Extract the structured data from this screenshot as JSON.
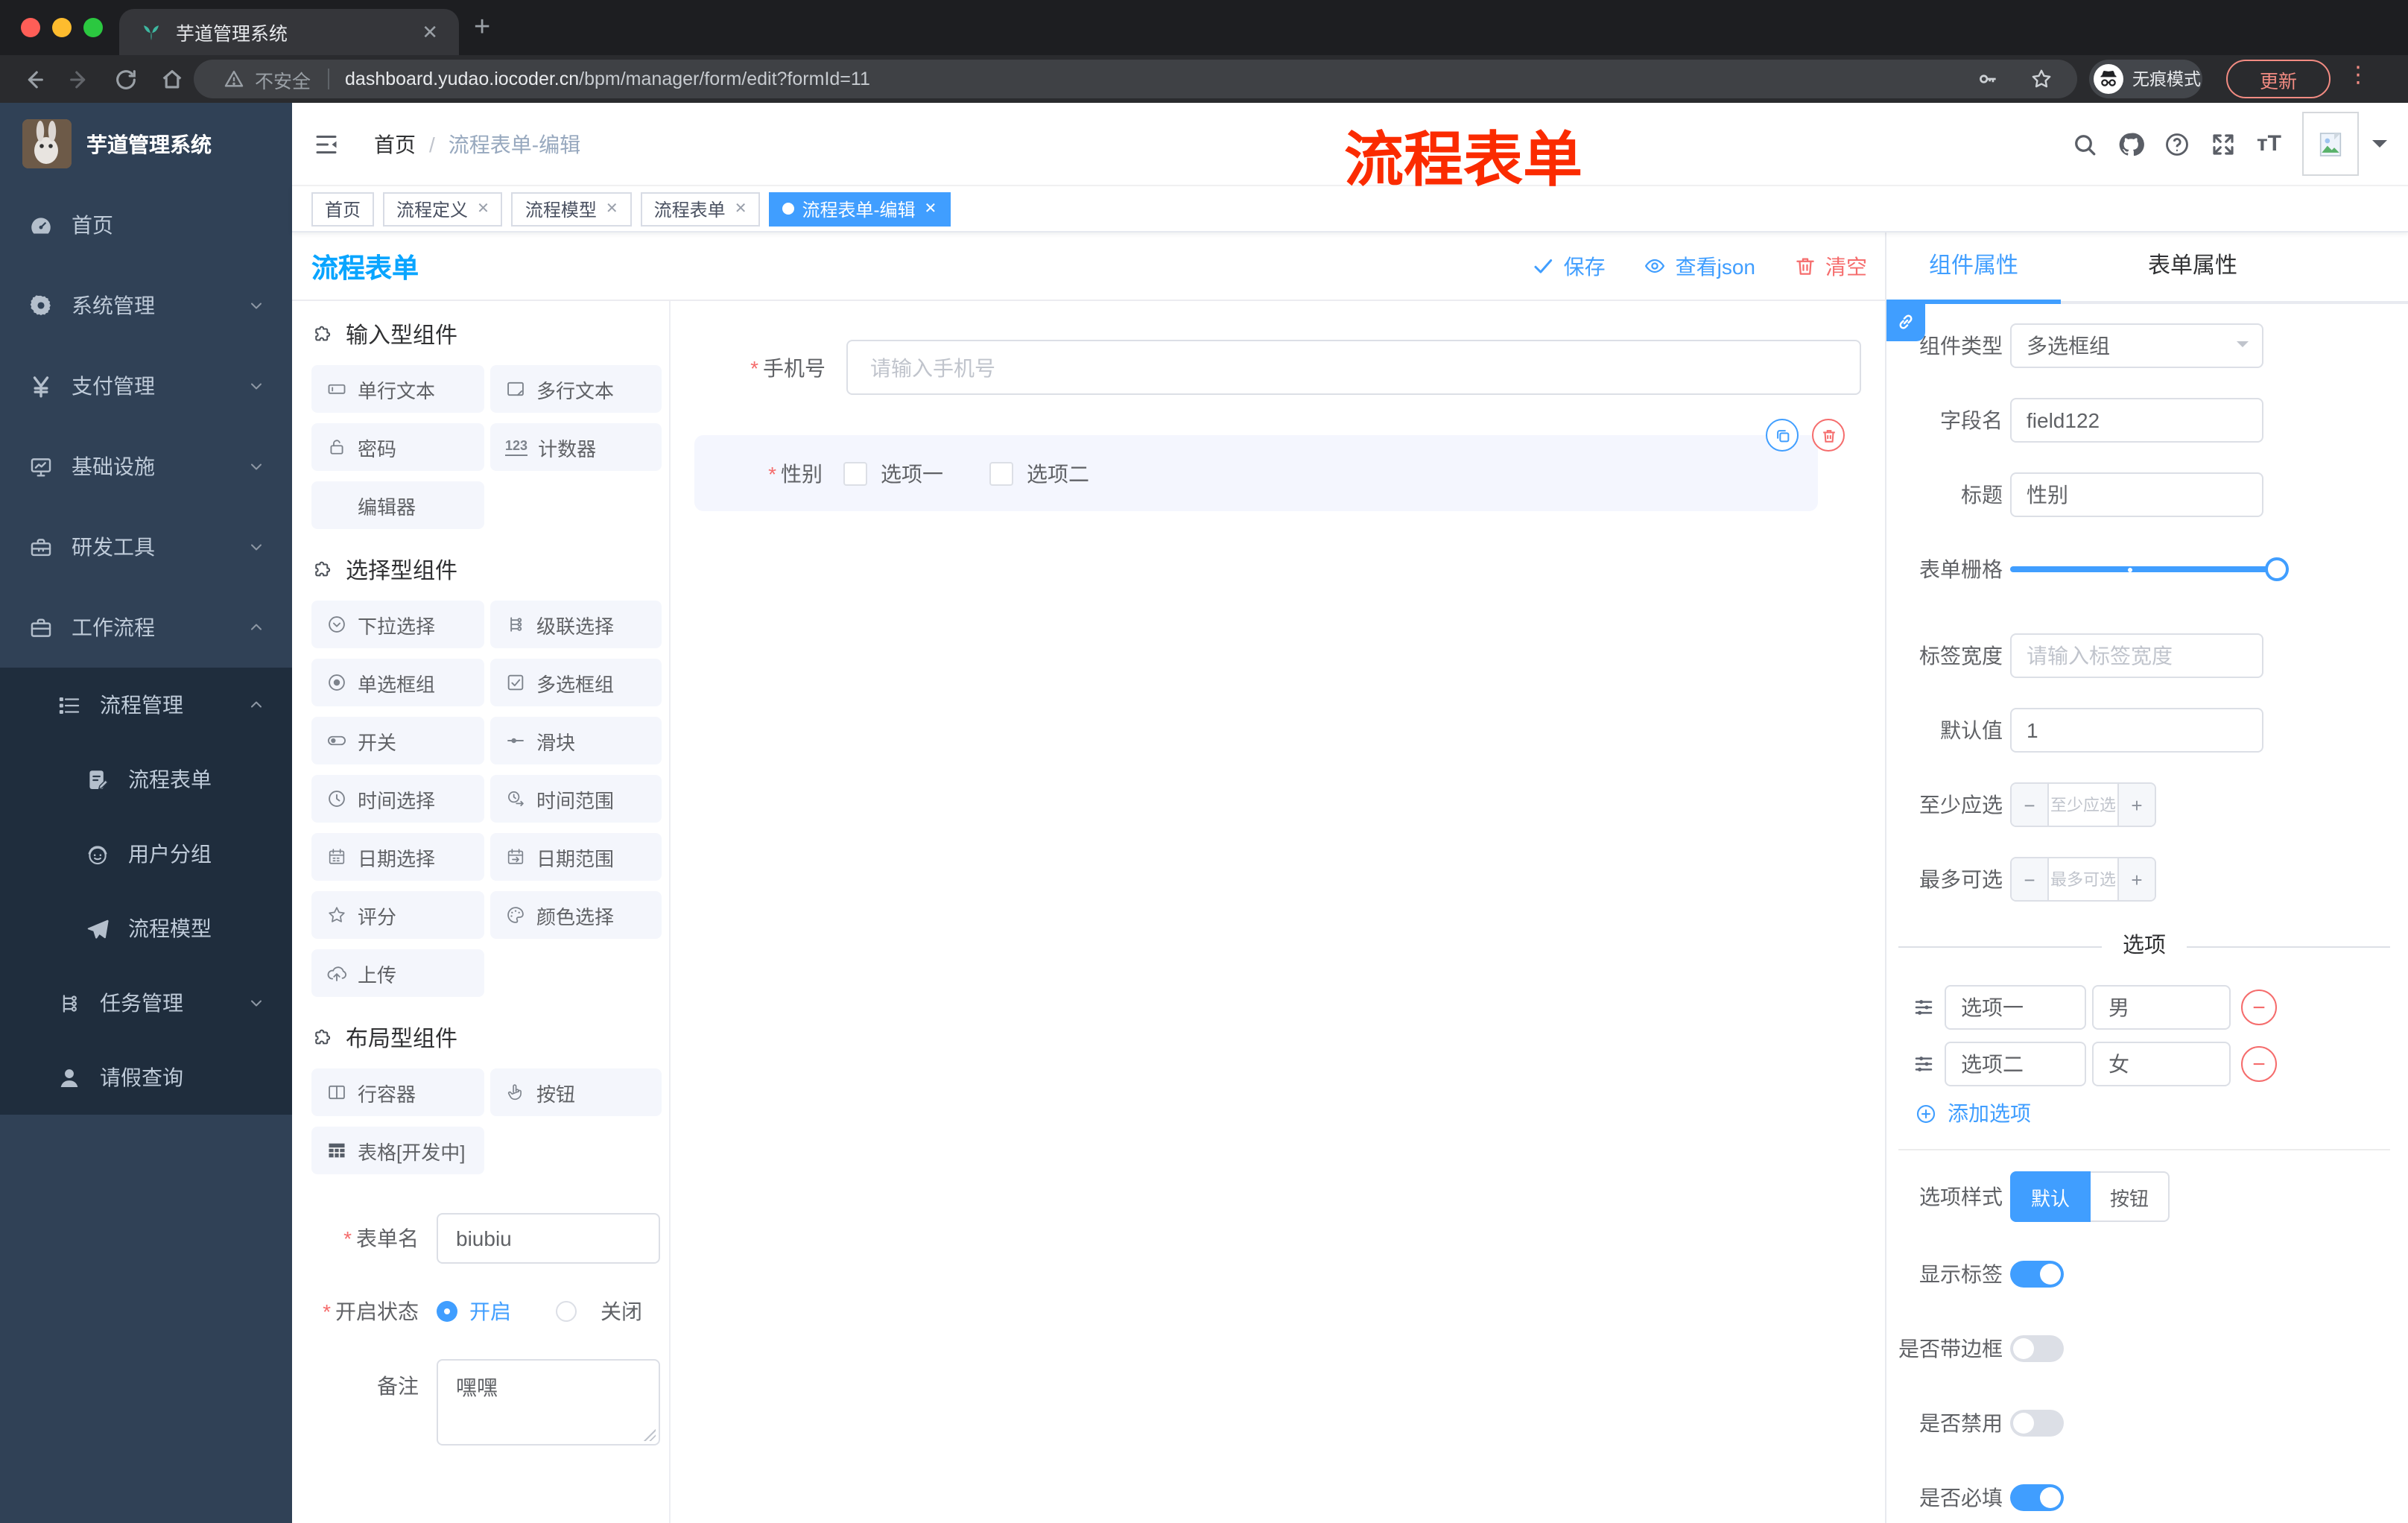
{
  "browser": {
    "tab_title": "芋道管理系统",
    "not_secure": "不安全",
    "url_domain": "dashboard.yudao.iocoder.cn",
    "url_path": "/bpm/manager/form/edit?formId=11",
    "incognito_label": "无痕模式",
    "update_label": "更新"
  },
  "header": {
    "breadcrumb_home": "首页",
    "breadcrumb_sep": "/",
    "breadcrumb_current": "流程表单-编辑",
    "annotation": "流程表单"
  },
  "sidebar": {
    "logo_title": "芋道管理系统",
    "items": [
      {
        "id": "home",
        "label": "首页",
        "icon": "dashboard",
        "level": 1,
        "chevron": ""
      },
      {
        "id": "system",
        "label": "系统管理",
        "icon": "gear",
        "level": 1,
        "chevron": "down"
      },
      {
        "id": "pay",
        "label": "支付管理",
        "icon": "yen",
        "level": 1,
        "chevron": "down"
      },
      {
        "id": "infra",
        "label": "基础设施",
        "icon": "monitor",
        "level": 1,
        "chevron": "down"
      },
      {
        "id": "devtool",
        "label": "研发工具",
        "icon": "toolbox",
        "level": 1,
        "chevron": "down"
      },
      {
        "id": "workflow",
        "label": "工作流程",
        "icon": "briefcase",
        "level": 1,
        "chevron": "up"
      },
      {
        "id": "process-mgmt",
        "label": "流程管理",
        "icon": "listcheck",
        "level": 2,
        "chevron": "up",
        "sub": true
      },
      {
        "id": "process-form",
        "label": "流程表单",
        "icon": "docedit",
        "level": 3,
        "chevron": "",
        "sub": true
      },
      {
        "id": "user-group",
        "label": "用户分组",
        "icon": "face",
        "level": 3,
        "chevron": "",
        "sub": true
      },
      {
        "id": "process-model",
        "label": "流程模型",
        "icon": "plane",
        "level": 3,
        "chevron": "",
        "sub": true
      },
      {
        "id": "task-mgmt",
        "label": "任务管理",
        "icon": "cascade",
        "level": 2,
        "chevron": "down",
        "sub": true
      },
      {
        "id": "leave-query",
        "label": "请假查询",
        "icon": "user",
        "level": 2,
        "chevron": "",
        "sub": true
      }
    ]
  },
  "tags": [
    {
      "label": "首页",
      "closable": false,
      "active": false
    },
    {
      "label": "流程定义",
      "closable": true,
      "active": false
    },
    {
      "label": "流程模型",
      "closable": true,
      "active": false
    },
    {
      "label": "流程表单",
      "closable": true,
      "active": false
    },
    {
      "label": "流程表单-编辑",
      "closable": true,
      "active": true
    }
  ],
  "designer": {
    "panel_title": "流程表单",
    "actions": [
      {
        "id": "save",
        "label": "保存",
        "icon": "check",
        "color": "blue"
      },
      {
        "id": "view-json",
        "label": "查看json",
        "icon": "eye",
        "color": "blue"
      },
      {
        "id": "clear",
        "label": "清空",
        "icon": "trash",
        "color": "red"
      }
    ],
    "sections": [
      {
        "title": "输入型组件",
        "items": [
          {
            "label": "单行文本",
            "icon": "inputbox"
          },
          {
            "label": "多行文本",
            "icon": "textareabox"
          },
          {
            "label": "密码",
            "icon": "lock"
          },
          {
            "label": "计数器",
            "icon": "counter"
          },
          {
            "label": "编辑器",
            "icon": ""
          }
        ]
      },
      {
        "title": "选择型组件",
        "items": [
          {
            "label": "下拉选择",
            "icon": "selectcircle"
          },
          {
            "label": "级联选择",
            "icon": "cascade"
          },
          {
            "label": "单选框组",
            "icon": "radio"
          },
          {
            "label": "多选框组",
            "icon": "checkboxicon"
          },
          {
            "label": "开关",
            "icon": "switchicon"
          },
          {
            "label": "滑块",
            "icon": "slidericon"
          },
          {
            "label": "时间选择",
            "icon": "clock"
          },
          {
            "label": "时间范围",
            "icon": "timerange"
          },
          {
            "label": "日期选择",
            "icon": "calendar"
          },
          {
            "label": "日期范围",
            "icon": "daterange"
          },
          {
            "label": "评分",
            "icon": "staricon"
          },
          {
            "label": "颜色选择",
            "icon": "palette"
          },
          {
            "label": "上传",
            "icon": "upload"
          }
        ]
      },
      {
        "title": "布局型组件",
        "items": [
          {
            "label": "行容器",
            "icon": "columns"
          },
          {
            "label": "按钮",
            "icon": "pointer"
          },
          {
            "label": "表格[开发中]",
            "icon": "tablegrid"
          }
        ]
      }
    ],
    "meta": {
      "form_name_label": "表单名",
      "form_name_value": "biubiu",
      "status_label": "开启状态",
      "status_on": "开启",
      "status_off": "关闭",
      "status_selected": "开启",
      "remark_label": "备注",
      "remark_value": "嘿嘿"
    }
  },
  "canvas": {
    "phone_label": "手机号",
    "phone_placeholder": "请输入手机号",
    "gender_label": "性别",
    "gender_options": [
      "选项一",
      "选项二"
    ],
    "gender_checked": [
      false,
      false
    ]
  },
  "props": {
    "tabs": [
      {
        "label": "组件属性",
        "active": true
      },
      {
        "label": "表单属性",
        "active": false
      }
    ],
    "rows": [
      {
        "type": "select",
        "name": "component-type",
        "label": "组件类型",
        "value": "多选框组"
      },
      {
        "type": "input",
        "name": "field-name",
        "label": "字段名",
        "value": "field122"
      },
      {
        "type": "input",
        "name": "title",
        "label": "标题",
        "value": "性别"
      },
      {
        "type": "slider",
        "name": "form-grid",
        "label": "表单栅格"
      },
      {
        "type": "input",
        "name": "label-width",
        "label": "标签宽度",
        "placeholder": "请输入标签宽度"
      },
      {
        "type": "input",
        "name": "default-value",
        "label": "默认值",
        "value": "1"
      },
      {
        "type": "stepper",
        "name": "min-select",
        "label": "至少应选",
        "placeholder": "至少应选"
      },
      {
        "type": "stepper",
        "name": "max-select",
        "label": "最多可选",
        "placeholder": "最多可选"
      },
      {
        "type": "divider",
        "text": "选项"
      },
      {
        "type": "option",
        "name": "option-1",
        "label_value": "选项一",
        "value": "男"
      },
      {
        "type": "option",
        "name": "option-2",
        "label_value": "选项二",
        "value": "女"
      },
      {
        "type": "addlink",
        "label": "添加选项"
      },
      {
        "type": "line"
      },
      {
        "type": "radiogroup",
        "name": "option-style",
        "label": "选项样式",
        "options": [
          "默认",
          "按钮"
        ],
        "active": 0
      },
      {
        "type": "switch",
        "name": "show-label",
        "label": "显示标签",
        "on": true
      },
      {
        "type": "switch",
        "name": "with-border",
        "label": "是否带边框",
        "on": false
      },
      {
        "type": "switch",
        "name": "disabled",
        "label": "是否禁用",
        "on": false
      },
      {
        "type": "switch",
        "name": "required",
        "label": "是否必填",
        "on": true
      }
    ]
  },
  "colors": {
    "accent": "#409eff",
    "danger": "#f56c6c",
    "panel_title": "#0aa5ff",
    "annotation": "#fb2b00",
    "sidebar_bg": "#304156",
    "submenu_bg": "#1f2d3d",
    "update_badge": "#f28b82"
  }
}
